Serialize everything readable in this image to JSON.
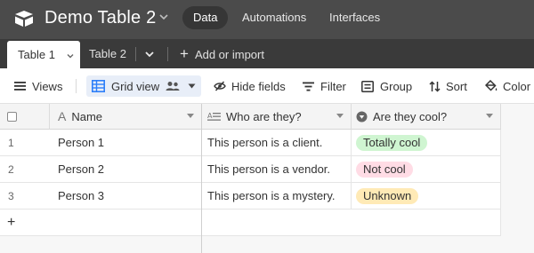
{
  "app": {
    "base_title": "Demo Table 2",
    "nav": [
      {
        "label": "Data",
        "active": true
      },
      {
        "label": "Automations",
        "active": false
      },
      {
        "label": "Interfaces",
        "active": false
      }
    ]
  },
  "tabs": {
    "items": [
      {
        "label": "Table 1",
        "active": true
      },
      {
        "label": "Table 2",
        "active": false
      }
    ],
    "add_label": "Add or import"
  },
  "toolbar": {
    "views_label": "Views",
    "grid_view_label": "Grid view",
    "hide_fields_label": "Hide fields",
    "filter_label": "Filter",
    "group_label": "Group",
    "sort_label": "Sort",
    "color_label": "Color"
  },
  "table": {
    "columns": [
      {
        "label": "Name",
        "icon": "text-type-icon"
      },
      {
        "label": "Who are they?",
        "icon": "long-text-icon"
      },
      {
        "label": "Are they cool?",
        "icon": "single-select-icon"
      }
    ],
    "rows": [
      {
        "num": "1",
        "name": "Person 1",
        "who": "This person is a client.",
        "cool": "Totally cool",
        "cool_color": "#cff5d1"
      },
      {
        "num": "2",
        "name": "Person 2",
        "who": "This person is a vendor.",
        "cool": "Not cool",
        "cool_color": "#ffdce5"
      },
      {
        "num": "3",
        "name": "Person 3",
        "who": "This person is a mystery.",
        "cool": "Unknown",
        "cool_color": "#ffeab6"
      }
    ],
    "add_row_symbol": "+"
  },
  "colors": {
    "topbar": "#4b4b4b",
    "tabbar": "#3a3a3a",
    "grid_view_accent": "#2d7ff9"
  }
}
